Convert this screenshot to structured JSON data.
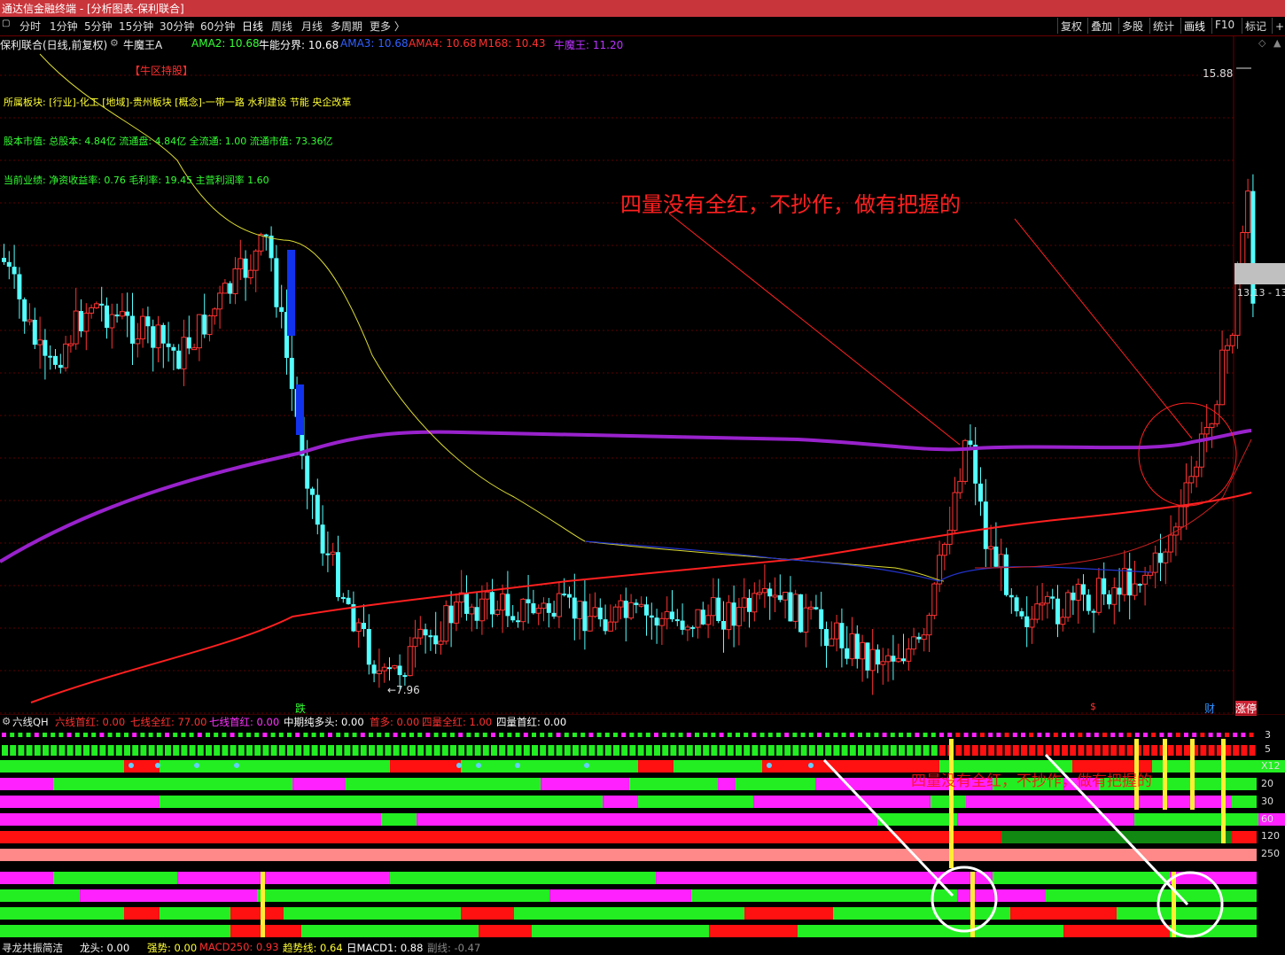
{
  "window": {
    "title": "通达信金融终端 - [分析图表-保利联合]"
  },
  "tabs": [
    {
      "label": "分时"
    },
    {
      "label": "1分钟"
    },
    {
      "label": "5分钟"
    },
    {
      "label": "15分钟"
    },
    {
      "label": "30分钟"
    },
    {
      "label": "60分钟"
    },
    {
      "label": "日线",
      "active": true
    },
    {
      "label": "周线"
    },
    {
      "label": "月线"
    },
    {
      "label": "多周期"
    },
    {
      "label": "更多 〉"
    }
  ],
  "toolbar_right": [
    {
      "label": "复权"
    },
    {
      "label": "叠加"
    },
    {
      "label": "多股"
    },
    {
      "label": "统计"
    },
    {
      "label": "画线",
      "active": true
    },
    {
      "label": "F10"
    },
    {
      "label": "标记"
    },
    {
      "label": "+自"
    }
  ],
  "stock": {
    "header": "保利联合(日线,前复权)",
    "indicator_name": "牛魔王A"
  },
  "ma_legend": [
    {
      "label": "AMA2: 10.68",
      "color": "#33ff33"
    },
    {
      "label": "牛能分界: 10.68",
      "color": "#ffffff"
    },
    {
      "label": "AMA3: 10.68",
      "color": "#3060ff"
    },
    {
      "label": "AMA4: 10.68",
      "color": "#ff3030"
    },
    {
      "label": "M168: 10.43",
      "color": "#ff3030"
    },
    {
      "label": "牛魔王: 11.20",
      "color": "#bb33ff"
    }
  ],
  "info": {
    "zone_tag": "【牛区持股】",
    "sector": "所属板块: [行业]-化工 [地域]-贵州板块 [概念]-一带一路 水利建设 节能 央企改革",
    "equity": "股本市值: 总股本: 4.84亿 流通盘: 4.84亿 全流通: 1.00 流通市值: 73.36亿",
    "performance": "当前业绩:  净资收益率: 0.76 毛利率: 19.45 主营利润率 1.60"
  },
  "annotation": {
    "text": "四量没有全红，不抄作，做有把握的",
    "overlay_text": "四量没有全红，不抄作，做有把握的"
  },
  "price_labels": {
    "high": "15.88",
    "low": "←7.96",
    "current": "13.13 - 13"
  },
  "markers": {
    "die": "跌",
    "cai": "财",
    "zhangting": "涨停"
  },
  "indicator": {
    "name": "六线QH",
    "values": [
      {
        "label": "六线首红: 0.00",
        "color": "#ff3030"
      },
      {
        "label": "七线全红: 77.00",
        "color": "#ff3030"
      },
      {
        "label": "七线首红: 0.00",
        "color": "#ff33ff"
      },
      {
        "label": "中期纯多头: 0.00",
        "color": "#ffffff"
      },
      {
        "label": "首多: 0.00",
        "color": "#ff3030"
      },
      {
        "label": "四量全红: 1.00",
        "color": "#ff3030"
      },
      {
        "label": "四量首红: 0.00",
        "color": "#ffffff"
      }
    ],
    "row_labels": [
      "3",
      "5",
      "X12",
      "20",
      "30",
      "60",
      "120",
      "250"
    ]
  },
  "bottom_indicator": {
    "name": "寻龙共振简洁",
    "values": [
      {
        "label": "龙头: 0.00",
        "color": "#ffffff"
      },
      {
        "label": "强势: 0.00",
        "color": "#ffff33"
      },
      {
        "label": "MACD250: 0.93",
        "color": "#ff3030"
      },
      {
        "label": "趋势线: 0.64",
        "color": "#ffff33"
      },
      {
        "label": "日MACD1: 0.88",
        "color": "#ffffff"
      },
      {
        "label": "副线: -0.47",
        "color": "#888888"
      }
    ]
  },
  "colors": {
    "up": "#ff3333",
    "down": "#54ffff",
    "bg": "#000000",
    "ma_purple": "#9922cc",
    "ma_red": "#ff2020",
    "ma_yellow": "#dddd33",
    "ma_blue": "#2233cc",
    "band_green": "#22ee22",
    "band_red": "#ff1111",
    "band_magenta": "#ff22ff",
    "band_pink": "#ff8888",
    "band_darkgreen": "#118811"
  }
}
